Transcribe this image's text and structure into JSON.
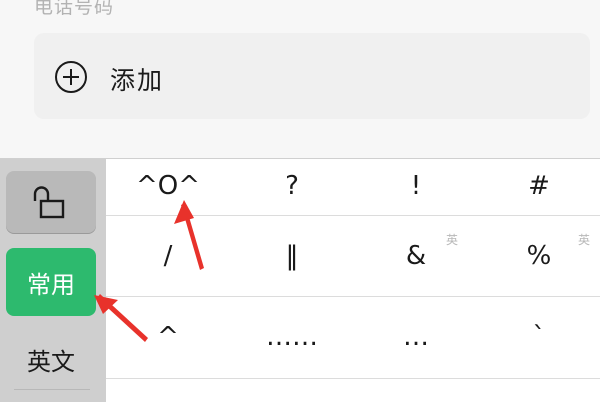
{
  "form": {
    "section_label": "电话号码",
    "add_label": "添加"
  },
  "keyboard": {
    "sidebar": {
      "common_label": "常用",
      "english_label": "英文"
    },
    "rows": [
      [
        "^O^",
        "?",
        "!",
        "#"
      ],
      [
        "/",
        "‖",
        "&",
        "%"
      ],
      [
        "^",
        "……",
        "…",
        "`"
      ]
    ],
    "badge": "英"
  },
  "colors": {
    "accent": "#2dba6e",
    "annotation": "#e8322b"
  },
  "icons": {
    "add": "plus-circle-icon",
    "lock": "unlock-icon"
  }
}
